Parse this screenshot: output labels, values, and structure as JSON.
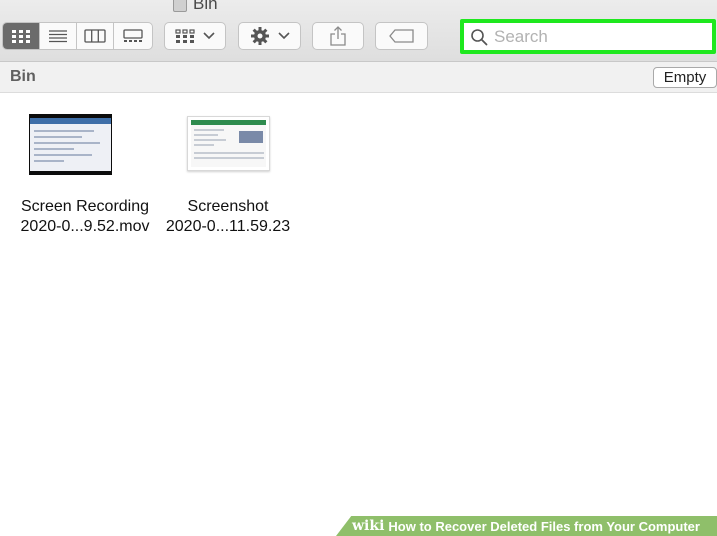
{
  "window": {
    "title": "Bin"
  },
  "toolbar": {
    "view_modes": [
      {
        "name": "icon-view",
        "active": true
      },
      {
        "name": "list-view",
        "active": false
      },
      {
        "name": "column-view",
        "active": false
      },
      {
        "name": "gallery-view",
        "active": false
      }
    ],
    "group_icon": "grid-icon",
    "action_icon": "gear-icon",
    "share_icon": "share-icon",
    "tag_icon": "tag-icon"
  },
  "search": {
    "placeholder": "Search",
    "value": "",
    "highlight_color": "#1ee81e"
  },
  "pathbar": {
    "folder_name": "Bin",
    "empty_label": "Empty"
  },
  "files": [
    {
      "line1": "Screen Recording",
      "line2": "2020-0...9.52.mov",
      "kind": "video"
    },
    {
      "line1": "Screenshot",
      "line2": "2020-0...11.59.23",
      "kind": "image"
    }
  ],
  "watermark": {
    "logo": "wiki",
    "text": "How to Recover Deleted Files from Your Computer"
  }
}
